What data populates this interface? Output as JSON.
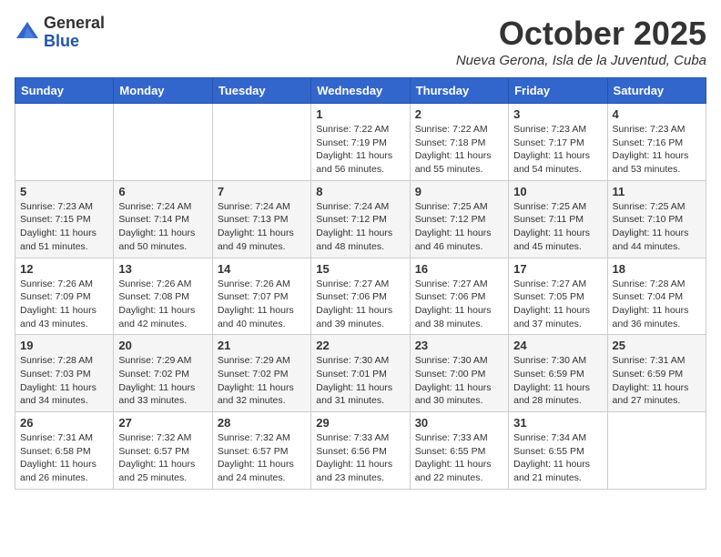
{
  "header": {
    "logo_general": "General",
    "logo_blue": "Blue",
    "month_title": "October 2025",
    "location": "Nueva Gerona, Isla de la Juventud, Cuba"
  },
  "weekdays": [
    "Sunday",
    "Monday",
    "Tuesday",
    "Wednesday",
    "Thursday",
    "Friday",
    "Saturday"
  ],
  "weeks": [
    [
      {
        "day": "",
        "info": ""
      },
      {
        "day": "",
        "info": ""
      },
      {
        "day": "",
        "info": ""
      },
      {
        "day": "1",
        "info": "Sunrise: 7:22 AM\nSunset: 7:19 PM\nDaylight: 11 hours and 56 minutes."
      },
      {
        "day": "2",
        "info": "Sunrise: 7:22 AM\nSunset: 7:18 PM\nDaylight: 11 hours and 55 minutes."
      },
      {
        "day": "3",
        "info": "Sunrise: 7:23 AM\nSunset: 7:17 PM\nDaylight: 11 hours and 54 minutes."
      },
      {
        "day": "4",
        "info": "Sunrise: 7:23 AM\nSunset: 7:16 PM\nDaylight: 11 hours and 53 minutes."
      }
    ],
    [
      {
        "day": "5",
        "info": "Sunrise: 7:23 AM\nSunset: 7:15 PM\nDaylight: 11 hours and 51 minutes."
      },
      {
        "day": "6",
        "info": "Sunrise: 7:24 AM\nSunset: 7:14 PM\nDaylight: 11 hours and 50 minutes."
      },
      {
        "day": "7",
        "info": "Sunrise: 7:24 AM\nSunset: 7:13 PM\nDaylight: 11 hours and 49 minutes."
      },
      {
        "day": "8",
        "info": "Sunrise: 7:24 AM\nSunset: 7:12 PM\nDaylight: 11 hours and 48 minutes."
      },
      {
        "day": "9",
        "info": "Sunrise: 7:25 AM\nSunset: 7:12 PM\nDaylight: 11 hours and 46 minutes."
      },
      {
        "day": "10",
        "info": "Sunrise: 7:25 AM\nSunset: 7:11 PM\nDaylight: 11 hours and 45 minutes."
      },
      {
        "day": "11",
        "info": "Sunrise: 7:25 AM\nSunset: 7:10 PM\nDaylight: 11 hours and 44 minutes."
      }
    ],
    [
      {
        "day": "12",
        "info": "Sunrise: 7:26 AM\nSunset: 7:09 PM\nDaylight: 11 hours and 43 minutes."
      },
      {
        "day": "13",
        "info": "Sunrise: 7:26 AM\nSunset: 7:08 PM\nDaylight: 11 hours and 42 minutes."
      },
      {
        "day": "14",
        "info": "Sunrise: 7:26 AM\nSunset: 7:07 PM\nDaylight: 11 hours and 40 minutes."
      },
      {
        "day": "15",
        "info": "Sunrise: 7:27 AM\nSunset: 7:06 PM\nDaylight: 11 hours and 39 minutes."
      },
      {
        "day": "16",
        "info": "Sunrise: 7:27 AM\nSunset: 7:06 PM\nDaylight: 11 hours and 38 minutes."
      },
      {
        "day": "17",
        "info": "Sunrise: 7:27 AM\nSunset: 7:05 PM\nDaylight: 11 hours and 37 minutes."
      },
      {
        "day": "18",
        "info": "Sunrise: 7:28 AM\nSunset: 7:04 PM\nDaylight: 11 hours and 36 minutes."
      }
    ],
    [
      {
        "day": "19",
        "info": "Sunrise: 7:28 AM\nSunset: 7:03 PM\nDaylight: 11 hours and 34 minutes."
      },
      {
        "day": "20",
        "info": "Sunrise: 7:29 AM\nSunset: 7:02 PM\nDaylight: 11 hours and 33 minutes."
      },
      {
        "day": "21",
        "info": "Sunrise: 7:29 AM\nSunset: 7:02 PM\nDaylight: 11 hours and 32 minutes."
      },
      {
        "day": "22",
        "info": "Sunrise: 7:30 AM\nSunset: 7:01 PM\nDaylight: 11 hours and 31 minutes."
      },
      {
        "day": "23",
        "info": "Sunrise: 7:30 AM\nSunset: 7:00 PM\nDaylight: 11 hours and 30 minutes."
      },
      {
        "day": "24",
        "info": "Sunrise: 7:30 AM\nSunset: 6:59 PM\nDaylight: 11 hours and 28 minutes."
      },
      {
        "day": "25",
        "info": "Sunrise: 7:31 AM\nSunset: 6:59 PM\nDaylight: 11 hours and 27 minutes."
      }
    ],
    [
      {
        "day": "26",
        "info": "Sunrise: 7:31 AM\nSunset: 6:58 PM\nDaylight: 11 hours and 26 minutes."
      },
      {
        "day": "27",
        "info": "Sunrise: 7:32 AM\nSunset: 6:57 PM\nDaylight: 11 hours and 25 minutes."
      },
      {
        "day": "28",
        "info": "Sunrise: 7:32 AM\nSunset: 6:57 PM\nDaylight: 11 hours and 24 minutes."
      },
      {
        "day": "29",
        "info": "Sunrise: 7:33 AM\nSunset: 6:56 PM\nDaylight: 11 hours and 23 minutes."
      },
      {
        "day": "30",
        "info": "Sunrise: 7:33 AM\nSunset: 6:55 PM\nDaylight: 11 hours and 22 minutes."
      },
      {
        "day": "31",
        "info": "Sunrise: 7:34 AM\nSunset: 6:55 PM\nDaylight: 11 hours and 21 minutes."
      },
      {
        "day": "",
        "info": ""
      }
    ]
  ]
}
